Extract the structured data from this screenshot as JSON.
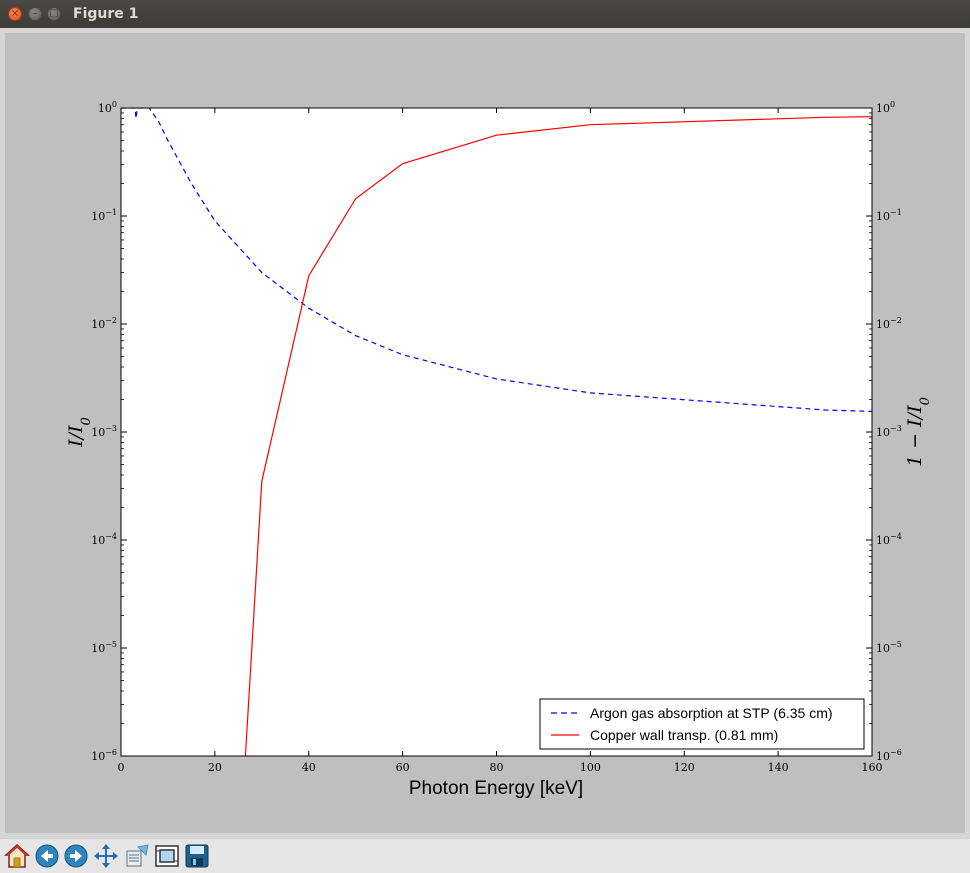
{
  "window": {
    "title": "Figure 1"
  },
  "toolbar": {
    "buttons": [
      {
        "name": "home-icon"
      },
      {
        "name": "back-icon"
      },
      {
        "name": "forward-icon"
      },
      {
        "name": "pan-icon"
      },
      {
        "name": "zoom-icon"
      },
      {
        "name": "configure-subplots-icon"
      },
      {
        "name": "save-icon"
      }
    ]
  },
  "chart_data": {
    "type": "line",
    "xlabel": "Photon Energy [keV]",
    "ylabel_left": "I/I0",
    "ylabel_right": "1 − I/I0",
    "xlim": [
      0,
      160
    ],
    "ylim": [
      1e-06,
      1
    ],
    "yscale": "log",
    "x_ticks": [
      "0",
      "20",
      "40",
      "60",
      "80",
      "100",
      "120",
      "140",
      "160"
    ],
    "y_ticks": [
      {
        "base": "10",
        "exp": "0"
      },
      {
        "base": "10",
        "exp": "−1"
      },
      {
        "base": "10",
        "exp": "−2"
      },
      {
        "base": "10",
        "exp": "−3"
      },
      {
        "base": "10",
        "exp": "−4"
      },
      {
        "base": "10",
        "exp": "−5"
      },
      {
        "base": "10",
        "exp": "−6"
      }
    ],
    "legend_position": "lower-right",
    "series": [
      {
        "name": "Argon gas absorption at STP (6.35 cm)",
        "color": "#0000ff",
        "style": "dashed",
        "x": [
          0,
          3,
          3.2,
          3.5,
          6,
          8,
          10,
          15,
          20,
          30,
          40,
          50,
          60,
          80,
          100,
          150,
          160
        ],
        "y": [
          1,
          1,
          0.8,
          1,
          1,
          0.75,
          0.5,
          0.2,
          0.09,
          0.03,
          0.014,
          0.0078,
          0.0052,
          0.0031,
          0.0023,
          0.0016,
          0.00155
        ]
      },
      {
        "name": "Copper wall transp. (0.81 mm)",
        "color": "#ff0000",
        "style": "solid",
        "x": [
          26.5,
          30,
          40,
          50,
          60,
          80,
          100,
          150,
          160
        ],
        "y": [
          1e-06,
          0.00035,
          0.028,
          0.145,
          0.305,
          0.56,
          0.7,
          0.82,
          0.83
        ]
      }
    ]
  }
}
